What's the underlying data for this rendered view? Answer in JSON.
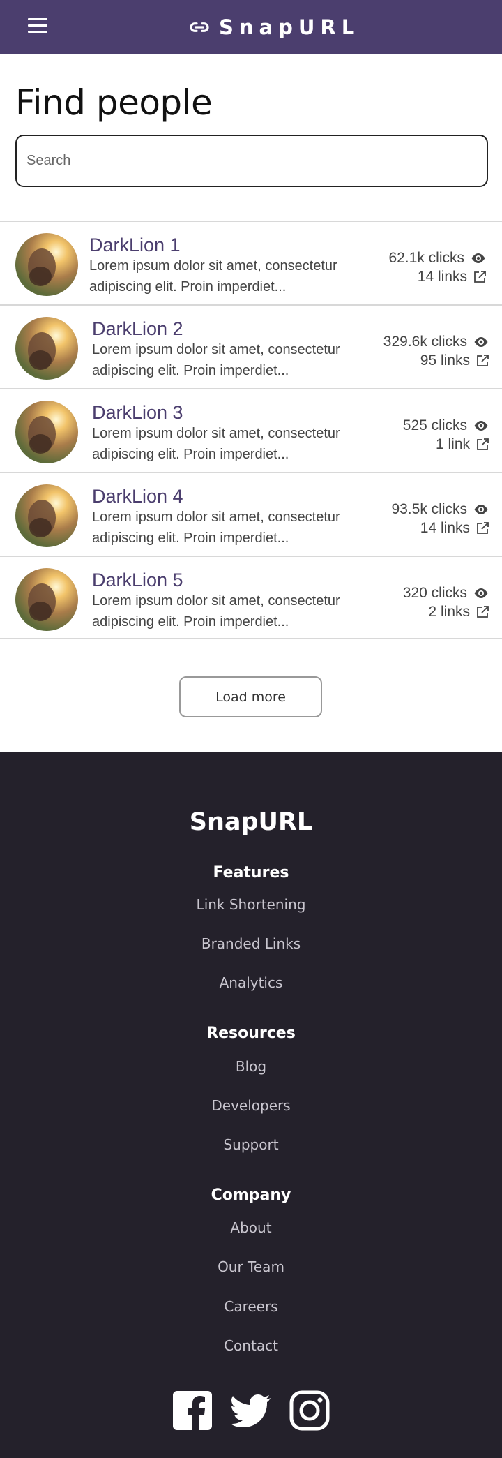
{
  "nav": {
    "brand": "SnapURL",
    "icons": {
      "menu": "hamburger-menu-icon",
      "logo": "link-icon"
    }
  },
  "page": {
    "title": "Find people"
  },
  "search": {
    "placeholder": "Search",
    "value": ""
  },
  "people": [
    {
      "name": "DarkLion 1",
      "description": "Lorem ipsum dolor sit amet, consectetur adipiscing elit. Proin imperdiet...",
      "clicks": "62.1k clicks",
      "links": "14 links"
    },
    {
      "name": "DarkLion 2",
      "description": "Lorem ipsum dolor sit amet, consectetur adipiscing elit. Proin imperdiet...",
      "clicks": "329.6k clicks",
      "links": "95 links"
    },
    {
      "name": "DarkLion 3",
      "description": "Lorem ipsum dolor sit amet, consectetur adipiscing elit. Proin imperdiet...",
      "clicks": "525 clicks",
      "links": "1 link"
    },
    {
      "name": "DarkLion 4",
      "description": "Lorem ipsum dolor sit amet, consectetur adipiscing elit. Proin imperdiet...",
      "clicks": "93.5k clicks",
      "links": "14 links"
    },
    {
      "name": "DarkLion 5",
      "description": "Lorem ipsum dolor sit amet, consectetur adipiscing elit. Proin imperdiet...",
      "clicks": "320 clicks",
      "links": "2 links"
    }
  ],
  "load_more": "Load more",
  "footer": {
    "brand": "SnapURL",
    "features": {
      "heading": "Features",
      "links": [
        "Link Shortening",
        "Branded Links",
        "Analytics"
      ]
    },
    "resources": {
      "heading": "Resources",
      "links": [
        "Blog",
        "Developers",
        "Support"
      ]
    },
    "company": {
      "heading": "Company",
      "links": [
        "About",
        "Our Team",
        "Careers",
        "Contact"
      ]
    },
    "socials": [
      "facebook-icon",
      "twitter-icon",
      "instagram-icon"
    ]
  },
  "colors": {
    "brand": "#4b3e6e",
    "footer_bg": "#24212b",
    "name": "#4b3e6e"
  }
}
